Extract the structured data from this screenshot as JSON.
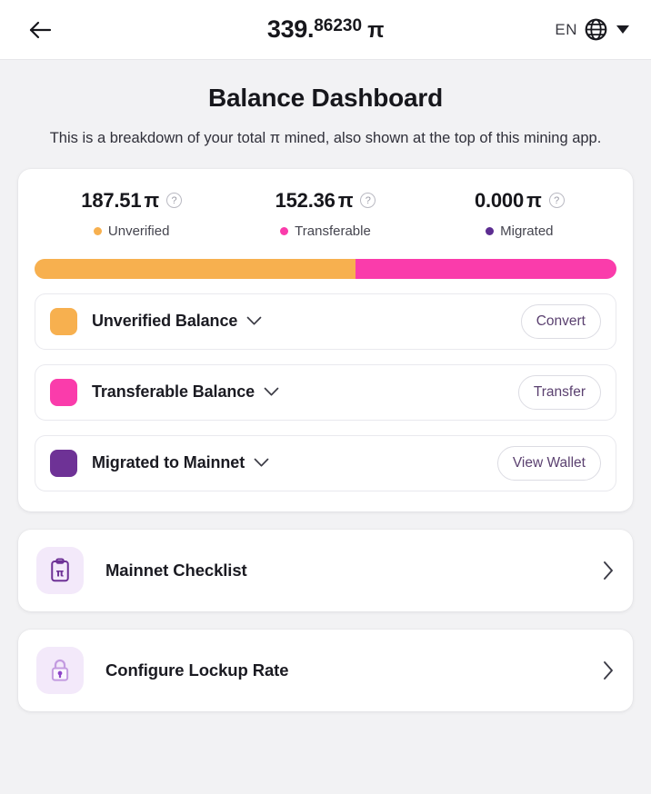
{
  "topbar": {
    "back_icon": "arrow-left-icon",
    "balance_whole": "339",
    "balance_separator": ".",
    "balance_fraction": "86230",
    "pi_symbol": "π",
    "language_code": "EN",
    "globe_icon": "globe-icon",
    "caret_icon": "chevron-down-icon"
  },
  "page": {
    "title": "Balance Dashboard",
    "description": "This is a breakdown of your total π mined, also shown at the top of this mining app."
  },
  "stats": [
    {
      "value": "187.51",
      "pi": "π",
      "help": "?",
      "legend": "Unverified",
      "color": "#f7b04f"
    },
    {
      "value": "152.36",
      "pi": "π",
      "help": "?",
      "legend": "Transferable",
      "color": "#fa3cab"
    },
    {
      "value": "0.000",
      "pi": "π",
      "help": "?",
      "legend": "Migrated",
      "color": "#5c2d91"
    }
  ],
  "progress": {
    "segments": [
      {
        "name": "unverified",
        "percent": 55.2,
        "color": "#f7b04f"
      },
      {
        "name": "transferable",
        "percent": 44.8,
        "color": "#fa3cab"
      }
    ]
  },
  "balance_rows": [
    {
      "label": "Unverified Balance",
      "color": "#f7b04f",
      "action": "Convert"
    },
    {
      "label": "Transferable Balance",
      "color": "#fa3cab",
      "action": "Transfer"
    },
    {
      "label": "Migrated to Mainnet",
      "color": "#6e3296",
      "action": "View Wallet"
    }
  ],
  "menu_items": [
    {
      "label": "Mainnet Checklist",
      "icon": "clipboard-pi-icon"
    },
    {
      "label": "Configure Lockup Rate",
      "icon": "padlock-icon"
    }
  ],
  "colors": {
    "unverified": "#f7b04f",
    "transferable": "#fa3cab",
    "migrated": "#5c2d91",
    "accent_purple": "#5b4170",
    "icon_tile_bg": "#f3e9fa",
    "page_bg": "#f2f2f4"
  }
}
